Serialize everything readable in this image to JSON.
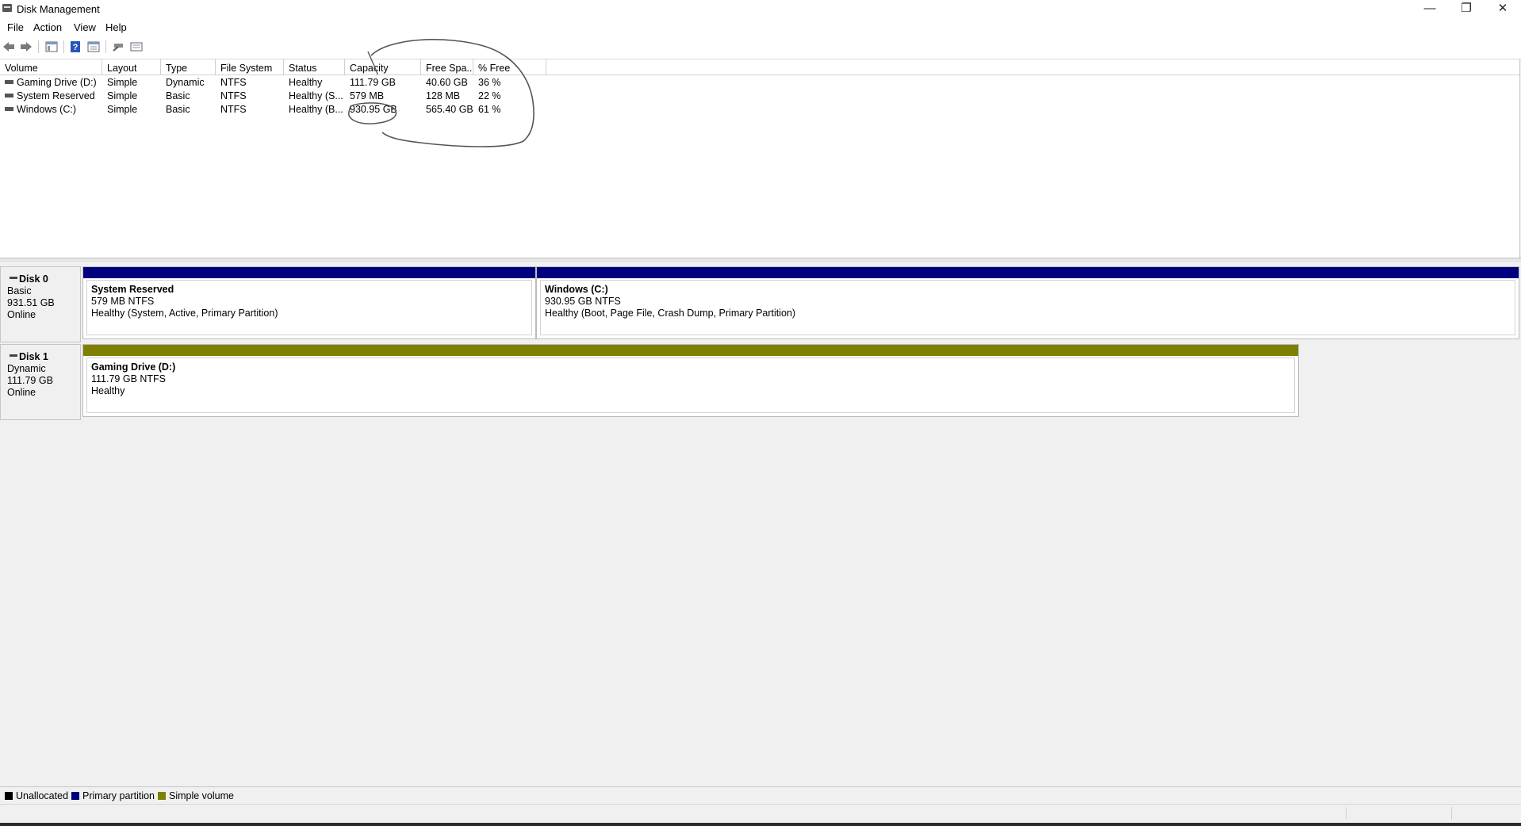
{
  "window": {
    "title": "Disk Management",
    "minimize_glyph": "—",
    "restore_glyph": "❐",
    "close_glyph": "✕"
  },
  "menu": [
    "File",
    "Action",
    "View",
    "Help"
  ],
  "toolbar": {
    "icons": [
      "back-arrow-icon",
      "forward-arrow-icon",
      "show-hide-console-tree-icon",
      "help-icon",
      "properties-icon",
      "connect-icon",
      "view-list-icon"
    ]
  },
  "volume_list": {
    "columns": [
      "Volume",
      "Layout",
      "Type",
      "File System",
      "Status",
      "Capacity",
      "Free Spa...",
      "% Free"
    ],
    "rows": [
      {
        "volume": "Gaming Drive (D:)",
        "layout": "Simple",
        "type": "Dynamic",
        "fs": "NTFS",
        "status": "Healthy",
        "capacity": "111.79 GB",
        "free": "40.60 GB",
        "pct": "36 %"
      },
      {
        "volume": "System Reserved",
        "layout": "Simple",
        "type": "Basic",
        "fs": "NTFS",
        "status": "Healthy (S...",
        "capacity": "579 MB",
        "free": "128 MB",
        "pct": "22 %"
      },
      {
        "volume": "Windows (C:)",
        "layout": "Simple",
        "type": "Basic",
        "fs": "NTFS",
        "status": "Healthy (B...",
        "capacity": "930.95 GB",
        "free": "565.40 GB",
        "pct": "61 %"
      }
    ]
  },
  "disks": [
    {
      "name": "Disk 0",
      "kind": "Basic",
      "size": "931.51 GB",
      "state": "Online",
      "partitions": [
        {
          "name": "System Reserved",
          "size_fs": "579 MB NTFS",
          "status": "Healthy (System, Active, Primary Partition)",
          "bar_color": "#00007f"
        },
        {
          "name": "Windows  (C:)",
          "size_fs": "930.95 GB NTFS",
          "status": "Healthy (Boot, Page File, Crash Dump, Primary Partition)",
          "bar_color": "#00007f"
        }
      ]
    },
    {
      "name": "Disk 1",
      "kind": "Dynamic",
      "size": "111.79 GB",
      "state": "Online",
      "partitions": [
        {
          "name": "Gaming Drive  (D:)",
          "size_fs": "111.79 GB NTFS",
          "status": "Healthy",
          "bar_color": "#7f7f00"
        }
      ]
    }
  ],
  "legend": [
    {
      "label": "Unallocated",
      "color": "#000000"
    },
    {
      "label": "Primary partition",
      "color": "#00007f"
    },
    {
      "label": "Simple volume",
      "color": "#7f7f00"
    }
  ]
}
